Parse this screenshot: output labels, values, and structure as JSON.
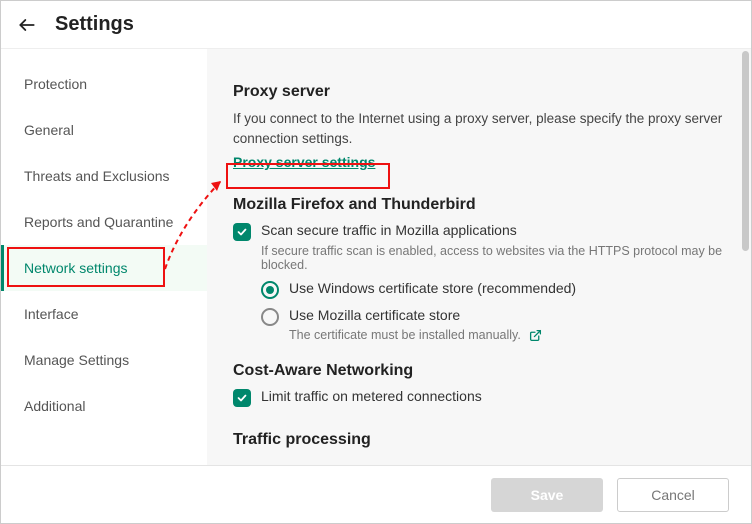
{
  "header": {
    "title": "Settings"
  },
  "sidebar": {
    "items": [
      {
        "label": "Protection"
      },
      {
        "label": "General"
      },
      {
        "label": "Threats and Exclusions"
      },
      {
        "label": "Reports and Quarantine"
      },
      {
        "label": "Network settings"
      },
      {
        "label": "Interface"
      },
      {
        "label": "Manage Settings"
      },
      {
        "label": "Additional"
      }
    ],
    "active_index": 4
  },
  "sections": {
    "proxy": {
      "title": "Proxy server",
      "description": "If you connect to the Internet using a proxy server, please specify the proxy server connection settings.",
      "link": "Proxy server settings"
    },
    "mozilla": {
      "title": "Mozilla Firefox and Thunderbird",
      "scan_label": "Scan secure traffic in Mozilla applications",
      "scan_hint": "If secure traffic scan is enabled, access to websites via the HTTPS protocol may be blocked.",
      "radio_windows": "Use Windows certificate store (recommended)",
      "radio_mozilla": "Use Mozilla certificate store",
      "radio_mozilla_hint": "The certificate must be installed manually."
    },
    "cost": {
      "title": "Cost-Aware Networking",
      "limit_label": "Limit traffic on metered connections"
    },
    "traffic": {
      "title": "Traffic processing"
    }
  },
  "footer": {
    "save": "Save",
    "cancel": "Cancel"
  }
}
